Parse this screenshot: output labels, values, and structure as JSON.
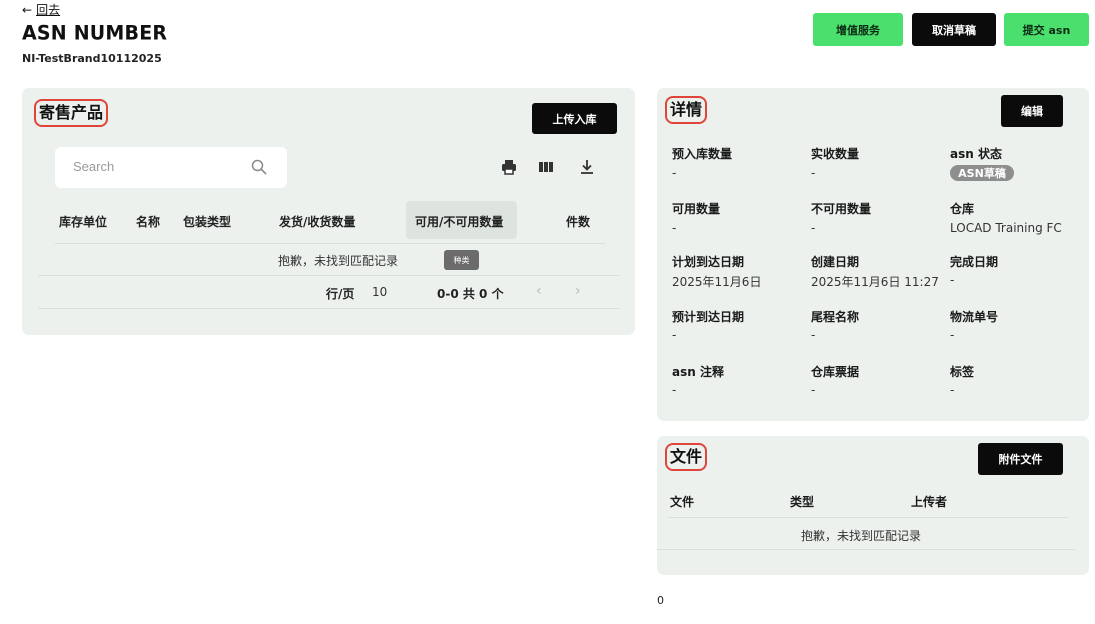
{
  "header": {
    "back_label": "回去",
    "title": "ASN NUMBER",
    "subtitle": "NI-TestBrand10112025"
  },
  "actions": {
    "value_added_label": "增值服务",
    "cancel_draft_label": "取消草稿",
    "submit_label": "提交 asn"
  },
  "products": {
    "title": "寄售产品",
    "upload_label": "上传入库",
    "search_placeholder": "Search",
    "columns": [
      "库存单位",
      "名称",
      "包装类型",
      "发货/收货数量",
      "可用/不可用数量",
      "件数"
    ],
    "empty_text": "抱歉，未找到匹配记录",
    "tooltip": "种类",
    "pagination": {
      "rows_label": "行/页",
      "rows_value": "10",
      "range_text": "0-0 共 0 个"
    }
  },
  "details": {
    "title": "详情",
    "edit_label": "编辑",
    "fields": [
      {
        "label": "预入库数量",
        "value": "-"
      },
      {
        "label": "实收数量",
        "value": "-"
      },
      {
        "label": "asn 状态",
        "value": "ASN草稿"
      },
      {
        "label": "可用数量",
        "value": "-"
      },
      {
        "label": "不可用数量",
        "value": "-"
      },
      {
        "label": "仓库",
        "value": "LOCAD Training FC"
      },
      {
        "label": "计划到达日期",
        "value": "2025年11月6日"
      },
      {
        "label": "创建日期",
        "value": "2025年11月6日 11:27"
      },
      {
        "label": "完成日期",
        "value": "-"
      },
      {
        "label": "预计到达日期",
        "value": "-"
      },
      {
        "label": "尾程名称",
        "value": "-"
      },
      {
        "label": "物流单号",
        "value": "-"
      },
      {
        "label": "asn 注释",
        "value": "-"
      },
      {
        "label": "仓库票据",
        "value": "-"
      },
      {
        "label": "标签",
        "value": "-"
      }
    ]
  },
  "files": {
    "title": "文件",
    "attach_label": "附件文件",
    "columns": [
      "文件",
      "类型",
      "上传者"
    ],
    "empty_text": "抱歉，未找到匹配记录"
  },
  "footer": {
    "counter": "0"
  },
  "icons": {
    "back": "arrow-left-icon",
    "search": "search-icon",
    "print": "print-icon",
    "columns": "columns-icon",
    "download": "download-icon",
    "prev": "chevron-left-icon",
    "next": "chevron-right-icon"
  },
  "colors": {
    "accent_green": "#4be06e",
    "dark": "#0b0b0b",
    "card_bg": "#ecf1ee",
    "highlight_red": "#e0453a",
    "badge_gray": "#8e8e8e"
  }
}
